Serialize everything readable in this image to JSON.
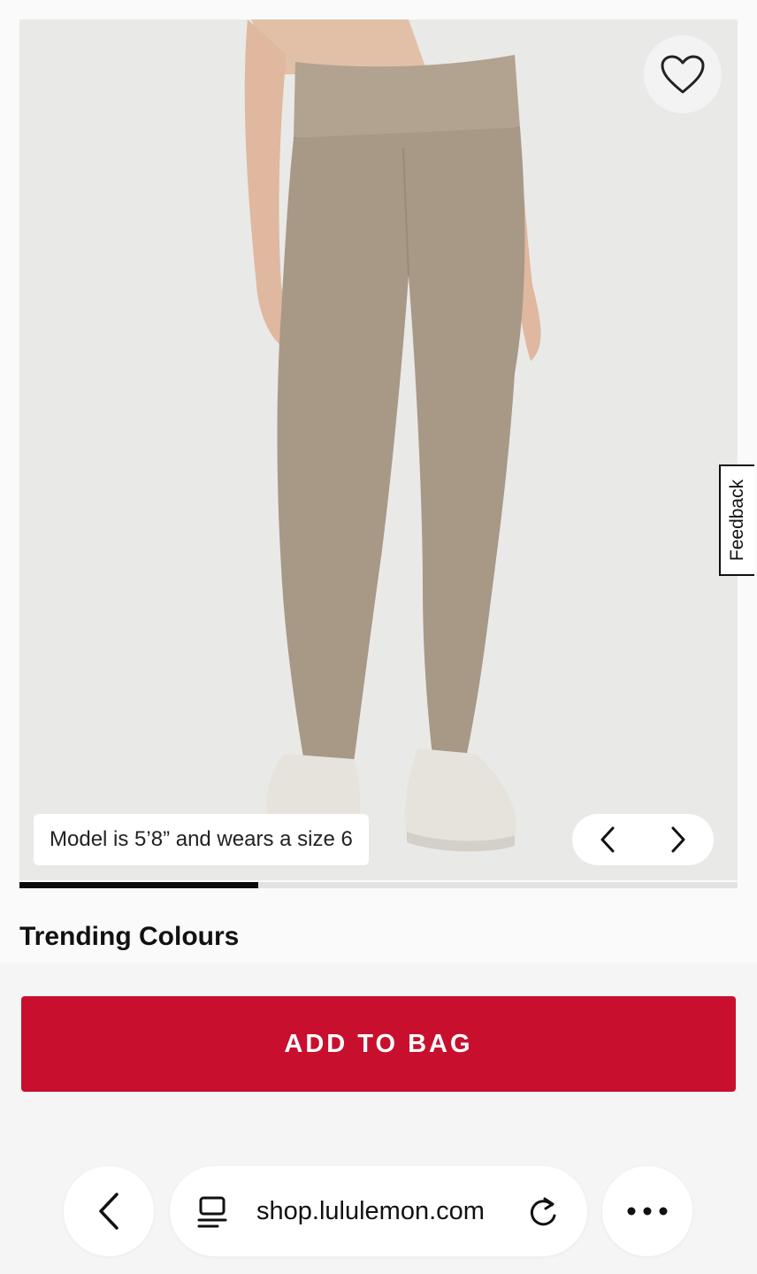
{
  "gallery": {
    "caption": "Model is 5’8” and wears a size 6",
    "image_index_progress": 0.333
  },
  "icons": {
    "favorite": "heart-outline-icon",
    "previous": "chevron-left-icon",
    "next": "chevron-right-icon",
    "back": "chevron-left-icon",
    "tabs": "tabs-icon",
    "reload": "reload-icon",
    "more": "more-dots-icon"
  },
  "feedback": {
    "label": "Feedback"
  },
  "section": {
    "title": "Trending Colours"
  },
  "cta": {
    "add_to_bag": "ADD TO BAG"
  },
  "browser": {
    "url": "shop.lululemon.com"
  },
  "colors": {
    "cta": "#c8102e",
    "legging": "#a89886",
    "background": "#e9e9e8"
  }
}
